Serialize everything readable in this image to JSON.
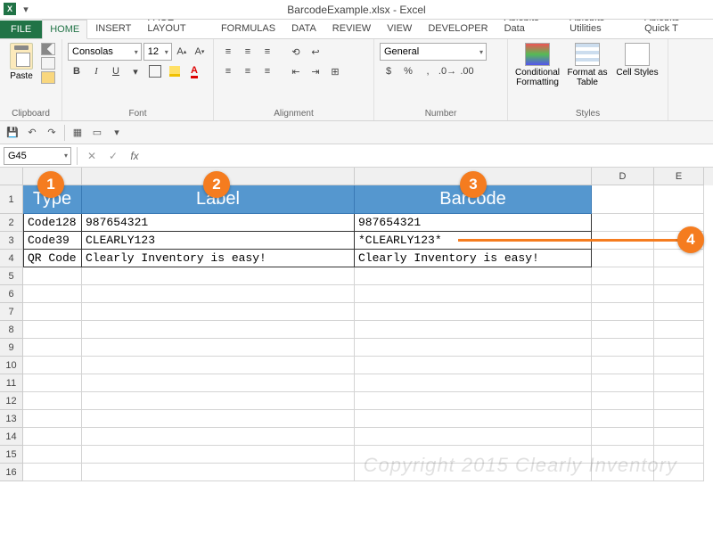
{
  "title": "BarcodeExample.xlsx - Excel",
  "menu": {
    "file": "FILE",
    "tabs": [
      "HOME",
      "INSERT",
      "PAGE LAYOUT",
      "FORMULAS",
      "DATA",
      "REVIEW",
      "VIEW",
      "DEVELOPER",
      "Ablebits Data",
      "Ablebits Utilities",
      "Ablebits Quick T"
    ]
  },
  "ribbon": {
    "clipboard": {
      "label": "Clipboard",
      "paste": "Paste"
    },
    "font": {
      "label": "Font",
      "name": "Consolas",
      "size": "12",
      "b": "B",
      "i": "I",
      "u": "U",
      "grow": "A",
      "shrink": "A"
    },
    "alignment": {
      "label": "Alignment"
    },
    "number": {
      "label": "Number",
      "format": "General"
    },
    "styles": {
      "label": "Styles",
      "cond": "Conditional Formatting",
      "cond2": "▾",
      "fmt": "Format as Table",
      "fmt2": "▾",
      "cell": "Cell Styles",
      "cell2": "▾"
    }
  },
  "namebox": "G45",
  "fx": "fx",
  "col_widths": {
    "A": 66,
    "B": 306,
    "C": 266,
    "D": 70,
    "E": 56
  },
  "table": {
    "headers": {
      "A": "Type",
      "B": "Label",
      "C": "Barcode"
    },
    "rows": [
      {
        "A": "Code128",
        "B": "987654321",
        "C": "987654321"
      },
      {
        "A": "Code39",
        "B": "CLEARLY123",
        "C": "*CLEARLY123*"
      },
      {
        "A": "QR Code",
        "B": "Clearly Inventory is easy!",
        "C": "Clearly Inventory is easy!"
      }
    ]
  },
  "callouts": {
    "1": "1",
    "2": "2",
    "3": "3",
    "4": "4"
  },
  "watermark": "Copyright 2015 Clearly Inventory"
}
